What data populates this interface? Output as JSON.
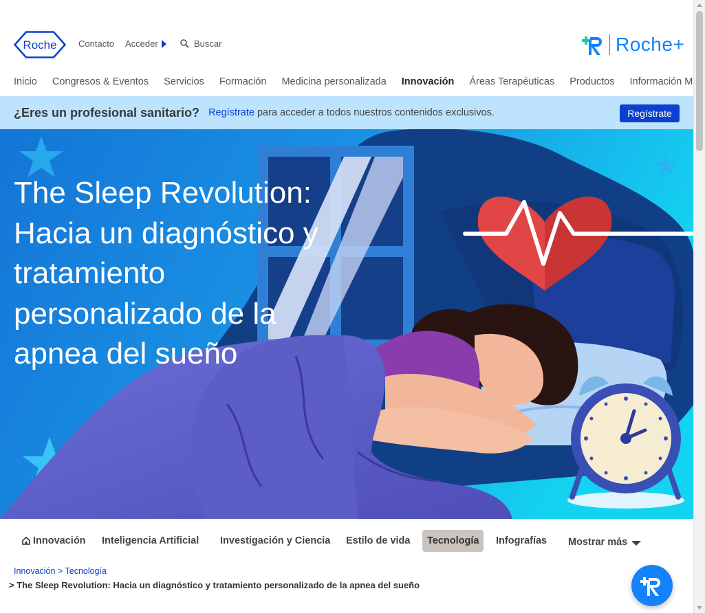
{
  "header": {
    "logo_text": "Roche",
    "contact": "Contacto",
    "login": "Acceder",
    "search": "Buscar",
    "brand": "Roche+"
  },
  "main_nav": [
    {
      "label": "Inicio",
      "active": false
    },
    {
      "label": "Congresos & Eventos",
      "active": false
    },
    {
      "label": "Servicios",
      "active": false
    },
    {
      "label": "Formación",
      "active": false
    },
    {
      "label": "Medicina personalizada",
      "active": false
    },
    {
      "label": "Innovación",
      "active": true
    },
    {
      "label": "Áreas Terapéuticas",
      "active": false
    },
    {
      "label": "Productos",
      "active": false
    },
    {
      "label": "Información Médica",
      "active": false
    }
  ],
  "promo": {
    "question": "¿Eres un profesional sanitario?",
    "link": "Regístrate",
    "text": "para acceder a todos nuestros contenidos exclusivos.",
    "button": "Regístrate"
  },
  "hero": {
    "title": "The Sleep Revolution: Hacia un diagnóstico y tratamiento personalizado de la apnea del sueño"
  },
  "sub_nav": {
    "home": "Innovación",
    "items": [
      "Inteligencia Artificial",
      "Investigación y Ciencia",
      "Estilo de vida",
      "Tecnología",
      "Infografías"
    ],
    "active": "Tecnología",
    "more": "Mostrar más"
  },
  "breadcrumb": {
    "items": [
      "Innovación",
      "Tecnología"
    ],
    "separator": ">",
    "current_prefix": ">",
    "current": "The Sleep Revolution: Hacia un diagnóstico y tratamiento personalizado de la apnea del sueño"
  },
  "colors": {
    "roche_blue": "#0b41cd",
    "brand_blue": "#1482fa",
    "promo_bg": "#bde3ff",
    "hero_sky": "#1c8ee0"
  }
}
